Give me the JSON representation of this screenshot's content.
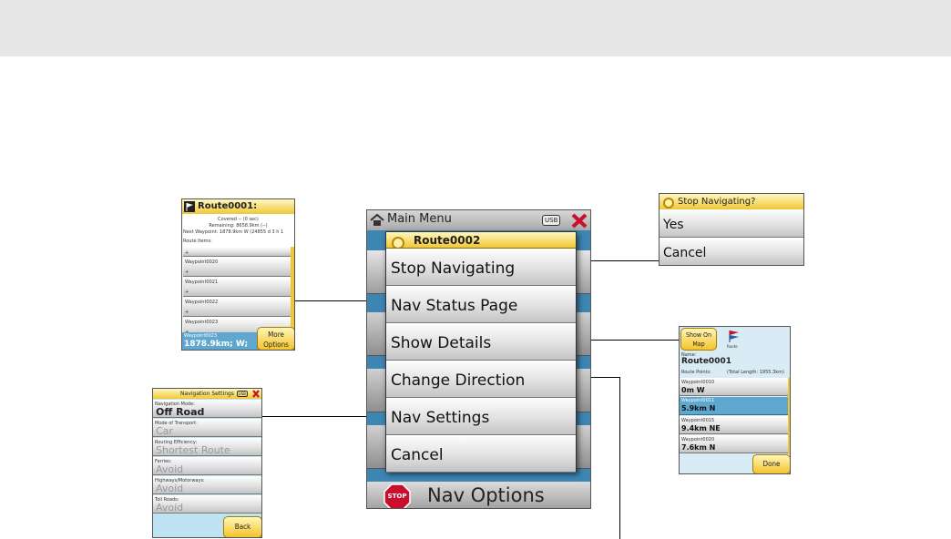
{
  "main": {
    "header": "Main Menu",
    "usb": "USB",
    "dialog_title": "Route0002",
    "items": [
      "Stop Navigating",
      "Nav Status Page",
      "Show Details",
      "Change Direction",
      "Nav Settings",
      "Cancel"
    ],
    "nav_options": "Nav Options",
    "stop_badge": "STOP"
  },
  "status": {
    "title": "Route0001:",
    "covered": "Covered -- (0 sec)",
    "remaining": "Remaining: 8658.9km (--)",
    "next": "Next Waypoint: 1878.9km W (24855 d 3 h 1",
    "items_label": "Route Items:",
    "rows": [
      {
        "name": "",
        "value": "+"
      },
      {
        "name": "Waypoint0020",
        "value": "+"
      },
      {
        "name": "Waypoint0021",
        "value": "+"
      },
      {
        "name": "Waypoint0022",
        "value": "+"
      },
      {
        "name": "Waypoint0023",
        "value": "+"
      }
    ],
    "selected_name": "Waypoint0023",
    "selected_value": "1878.9km; W;",
    "more_button": "More Options"
  },
  "confirm": {
    "title": "Stop Navigating?",
    "yes": "Yes",
    "cancel": "Cancel"
  },
  "details": {
    "show_on_map": "Show On Map",
    "route_icon_label": "Route",
    "name_label": "Name:",
    "name": "Route0001",
    "points_label": "Route Points:",
    "total_length": "(Total Length: 1955.3km)",
    "points": [
      {
        "name": "Waypoint0010",
        "value": "0m W",
        "selected": false
      },
      {
        "name": "Waypoint0011",
        "value": "5.9km N",
        "selected": true
      },
      {
        "name": "Waypoint0015",
        "value": "9.4km NE",
        "selected": false
      },
      {
        "name": "Waypoint0020",
        "value": "7.6km N",
        "selected": false
      }
    ],
    "done": "Done"
  },
  "settings": {
    "title": "Navigation Settings",
    "usb": "USB",
    "fields": [
      {
        "label": "Navigation Mode:",
        "value": "Off Road",
        "active": true
      },
      {
        "label": "Mode of Transport:",
        "value": "Car",
        "active": false
      },
      {
        "label": "Routing Efficiency:",
        "value": "Shortest Route",
        "active": false
      },
      {
        "label": "Ferries:",
        "value": "Avoid",
        "active": false
      },
      {
        "label": "Highways/Motorways:",
        "value": "Avoid",
        "active": false
      },
      {
        "label": "Toll Roads:",
        "value": "Avoid",
        "active": false
      }
    ],
    "back": "Back"
  },
  "colors": {
    "title_gold": "#f0c836",
    "selected_blue": "#5fa7cf",
    "stop_red": "#c8102e",
    "blue_backdrop": "#3d86b4"
  }
}
